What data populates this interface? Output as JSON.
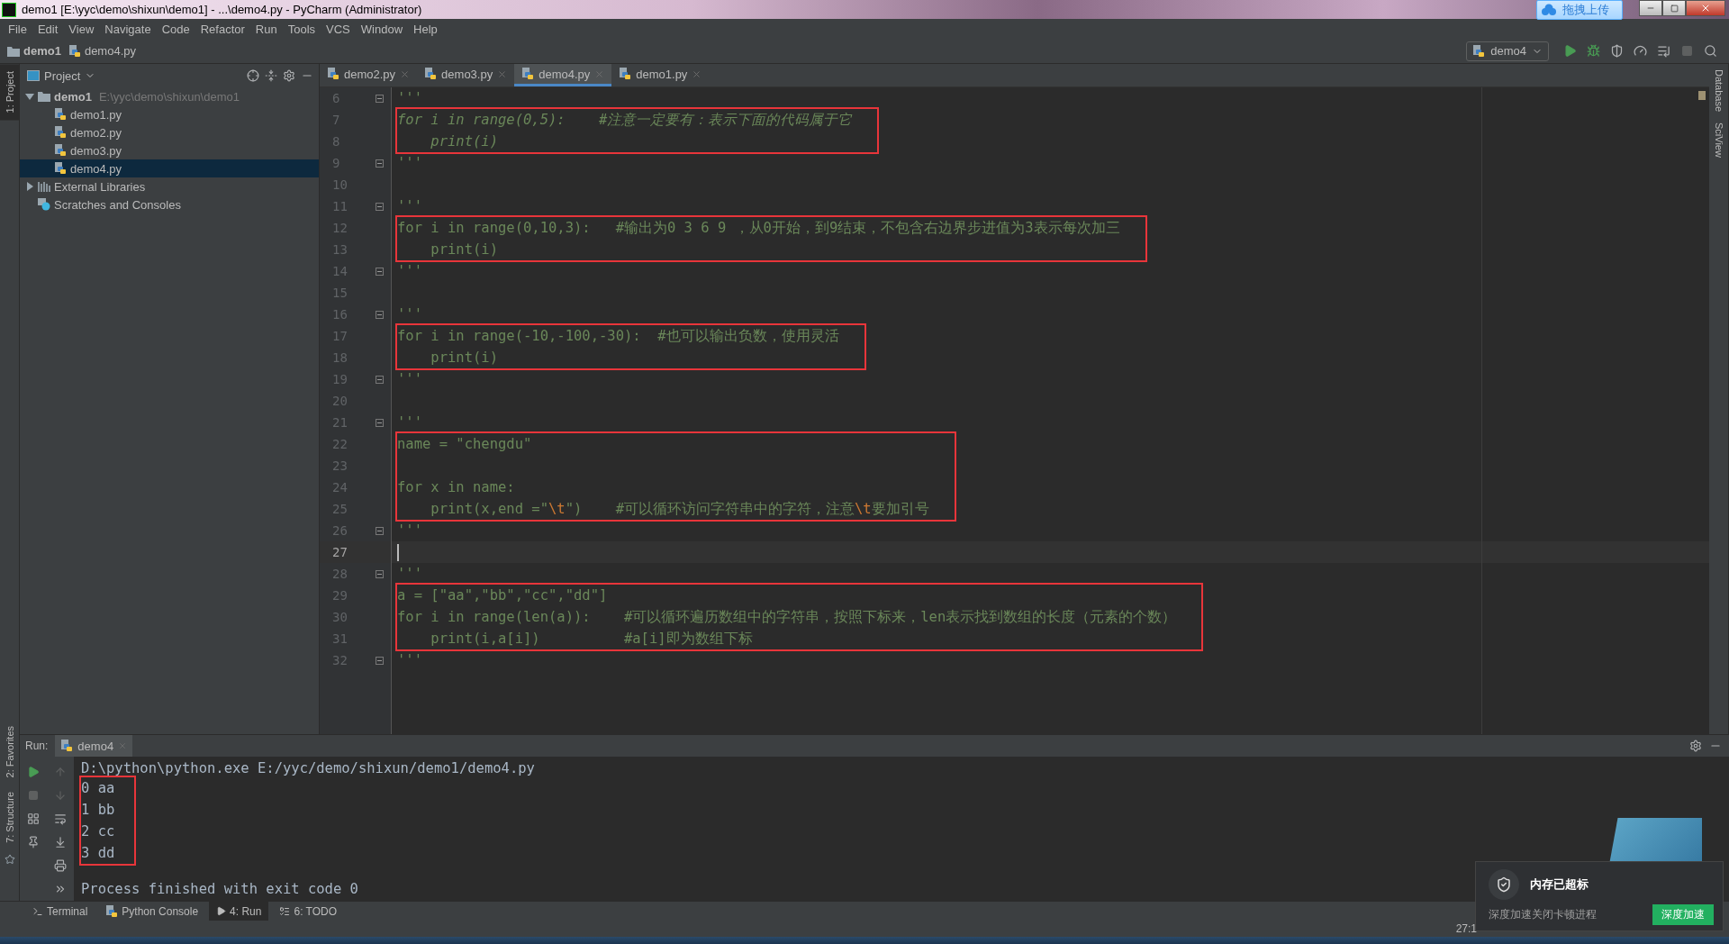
{
  "window": {
    "title": "demo1 [E:\\yyc\\demo\\shixun\\demo1] - ...\\demo4.py - PyCharm (Administrator)",
    "upload_button": "拖拽上传"
  },
  "menu": [
    "File",
    "Edit",
    "View",
    "Navigate",
    "Code",
    "Refactor",
    "Run",
    "Tools",
    "VCS",
    "Window",
    "Help"
  ],
  "breadcrumb": [
    {
      "label": "demo1",
      "kind": "folder"
    },
    {
      "label": "demo4.py",
      "kind": "python"
    }
  ],
  "run_config": "demo4",
  "left_strip": {
    "top": [
      {
        "label": "1: Project",
        "selected": true
      }
    ],
    "bottom": [
      {
        "label": "2: Favorites",
        "selected": false
      },
      {
        "label": "7: Structure",
        "selected": false
      }
    ]
  },
  "right_strip": [
    "Database",
    "SciView"
  ],
  "project": {
    "title": "Project",
    "tree": [
      {
        "label": "demo1",
        "path": "E:\\yyc\\demo\\shixun\\demo1",
        "kind": "folder",
        "expanded": true,
        "selected": false,
        "children": [
          {
            "label": "demo1.py",
            "kind": "python",
            "selected": false
          },
          {
            "label": "demo2.py",
            "kind": "python",
            "selected": false
          },
          {
            "label": "demo3.py",
            "kind": "python",
            "selected": false
          },
          {
            "label": "demo4.py",
            "kind": "python",
            "selected": true
          }
        ]
      },
      {
        "label": "External Libraries",
        "kind": "library",
        "expanded": false,
        "selected": false
      },
      {
        "label": "Scratches and Consoles",
        "kind": "scratch",
        "selected": false
      }
    ]
  },
  "editor_tabs": [
    {
      "label": "demo2.py",
      "selected": false
    },
    {
      "label": "demo3.py",
      "selected": false
    },
    {
      "label": "demo4.py",
      "selected": true
    },
    {
      "label": "demo1.py",
      "selected": false
    }
  ],
  "code": [
    {
      "kind": "line",
      "n": "6",
      "fold": true,
      "segments": [
        {
          "kind": "plain",
          "text": "'''"
        }
      ]
    },
    {
      "kind": "highlight",
      "lines": [
        {
          "n": "7",
          "italic": true,
          "segments": [
            {
              "kind": "plain",
              "text": "for i in range(0,5):    #注意一定要有：表示下面的代码属于它"
            }
          ]
        },
        {
          "n": "8",
          "italic": true,
          "segments": [
            {
              "kind": "plain",
              "text": "    print(i)"
            }
          ]
        }
      ]
    },
    {
      "kind": "line",
      "n": "9",
      "fold": true,
      "segments": [
        {
          "kind": "plain",
          "text": "'''"
        }
      ]
    },
    {
      "kind": "line",
      "n": "10"
    },
    {
      "kind": "line",
      "n": "11",
      "fold": true,
      "segments": [
        {
          "kind": "plain",
          "text": "'''"
        }
      ]
    },
    {
      "kind": "highlight",
      "lines": [
        {
          "n": "12",
          "segments": [
            {
              "kind": "plain",
              "text": "for i in range(0,10,3):   #输出为0 3 6 9 ，从0开始，到9结束，不包含右边界步进值为3表示每次加三"
            }
          ]
        },
        {
          "n": "13",
          "segments": [
            {
              "kind": "plain",
              "text": "    print(i)"
            }
          ]
        }
      ]
    },
    {
      "kind": "line",
      "n": "14",
      "fold": true,
      "segments": [
        {
          "kind": "plain",
          "text": "'''"
        }
      ]
    },
    {
      "kind": "line",
      "n": "15"
    },
    {
      "kind": "line",
      "n": "16",
      "fold": true,
      "segments": [
        {
          "kind": "plain",
          "text": "'''"
        }
      ]
    },
    {
      "kind": "highlight",
      "lines": [
        {
          "n": "17",
          "segments": [
            {
              "kind": "plain",
              "text": "for i in range(-10,-100,-30):  #也可以输出负数，使用灵活"
            }
          ]
        },
        {
          "n": "18",
          "segments": [
            {
              "kind": "plain",
              "text": "    print(i)"
            }
          ]
        }
      ]
    },
    {
      "kind": "line",
      "n": "19",
      "fold": true,
      "segments": [
        {
          "kind": "plain",
          "text": "'''"
        }
      ]
    },
    {
      "kind": "line",
      "n": "20"
    },
    {
      "kind": "line",
      "n": "21",
      "fold": true,
      "segments": [
        {
          "kind": "plain",
          "text": "'''"
        }
      ]
    },
    {
      "kind": "highlight",
      "lines": [
        {
          "n": "22",
          "segments": [
            {
              "kind": "plain",
              "text": "name = \"chengdu\""
            }
          ]
        },
        {
          "n": "23"
        },
        {
          "n": "24",
          "segments": [
            {
              "kind": "plain",
              "text": "for x in name:"
            }
          ]
        },
        {
          "n": "25",
          "segments": [
            {
              "kind": "plain",
              "text": "    print(x,end =\""
            },
            {
              "kind": "escape",
              "text": "\\t"
            },
            {
              "kind": "plain",
              "text": "\")    #可以循环访问字符串中的字符，注意"
            },
            {
              "kind": "escape",
              "text": "\\t"
            },
            {
              "kind": "plain",
              "text": "要加引号"
            }
          ]
        }
      ]
    },
    {
      "kind": "line",
      "n": "26",
      "fold": true,
      "segments": [
        {
          "kind": "plain",
          "text": "'''"
        }
      ]
    },
    {
      "kind": "line",
      "n": "27",
      "current": true
    },
    {
      "kind": "line",
      "n": "28",
      "fold": true,
      "segments": [
        {
          "kind": "plain",
          "text": "'''"
        }
      ]
    },
    {
      "kind": "highlight",
      "lines": [
        {
          "n": "29",
          "segments": [
            {
              "kind": "plain",
              "text": "a = [\"aa\",\"bb\",\"cc\",\"dd\"]"
            }
          ]
        },
        {
          "n": "30",
          "segments": [
            {
              "kind": "plain",
              "text": "for i in range(len(a)):    #可以循环遍历数组中的字符串，按照下标来，len表示找到数组的长度（元素的个数）"
            }
          ]
        },
        {
          "n": "31",
          "segments": [
            {
              "kind": "plain",
              "text": "    print(i,a[i])          #a[i]即为数组下标"
            }
          ]
        }
      ]
    },
    {
      "kind": "line",
      "n": "32",
      "fold": true,
      "segments": [
        {
          "kind": "plain",
          "text": "'''"
        }
      ]
    }
  ],
  "run": {
    "title": "Run:",
    "tab": "demo4",
    "console": [
      {
        "kind": "line",
        "text": "D:\\python\\python.exe E:/yyc/demo/shixun/demo1/demo4.py"
      },
      {
        "kind": "highlight",
        "lines": [
          "0 aa",
          "1 bb",
          "2 cc",
          "3 dd"
        ]
      },
      {
        "kind": "blank"
      },
      {
        "kind": "line",
        "text": "Process finished with exit code 0"
      }
    ]
  },
  "bottom_tabs": [
    {
      "label": "Terminal",
      "kind": "terminal",
      "selected": false
    },
    {
      "label": "Python Console",
      "kind": "python",
      "selected": false
    },
    {
      "label": "4: Run",
      "kind": "run",
      "selected": true
    },
    {
      "label": "6: TODO",
      "kind": "todo",
      "selected": false
    }
  ],
  "status": {
    "position": "27:1"
  },
  "notification": {
    "title": "内存已超标",
    "message": "深度加速关闭卡顿进程",
    "button": "深度加速"
  }
}
